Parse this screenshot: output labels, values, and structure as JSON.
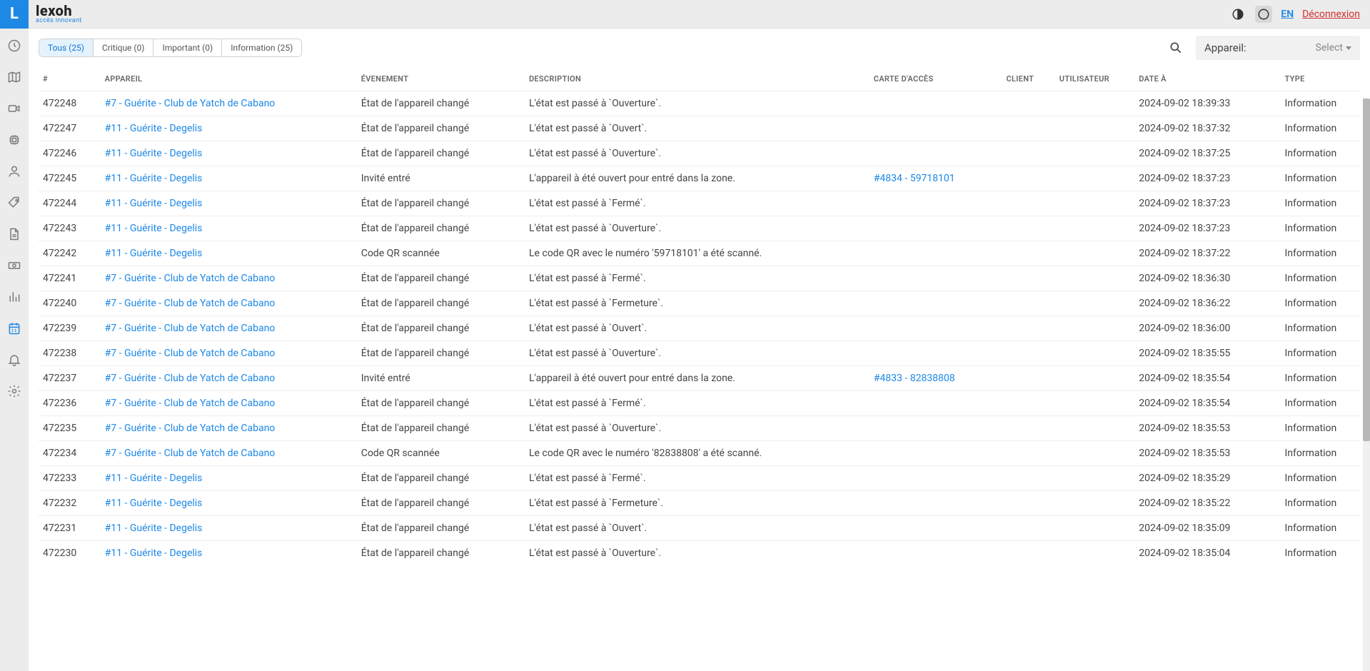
{
  "brand": {
    "name": "lexoh",
    "tagline": "accès innovant"
  },
  "topbar": {
    "lang": "EN",
    "logout": "Déconnexion"
  },
  "tabs": [
    {
      "label": "Tous (25)",
      "active": true
    },
    {
      "label": "Critique (0)",
      "active": false
    },
    {
      "label": "Important (0)",
      "active": false
    },
    {
      "label": "Information (25)",
      "active": false
    }
  ],
  "deviceFilter": {
    "label": "Appareil:",
    "select": "Select"
  },
  "columns": {
    "id": "#",
    "device": "APPAREIL",
    "event": "ÉVENEMENT",
    "description": "DESCRIPTION",
    "card": "CARTE D'ACCÈS",
    "client": "CLIENT",
    "user": "UTILISATEUR",
    "date": "DATE À",
    "type": "TYPE"
  },
  "rows": [
    {
      "id": "472248",
      "device": "#7 - Guérite - Club de Yatch de Cabano",
      "event": "État de l'appareil changé",
      "description": "L'état est passé à `Ouverture`.",
      "card": "",
      "date": "2024-09-02 18:39:33",
      "type": "Information"
    },
    {
      "id": "472247",
      "device": "#11 - Guérite - Degelis",
      "event": "État de l'appareil changé",
      "description": "L'état est passé à `Ouvert`.",
      "card": "",
      "date": "2024-09-02 18:37:32",
      "type": "Information"
    },
    {
      "id": "472246",
      "device": "#11 - Guérite - Degelis",
      "event": "État de l'appareil changé",
      "description": "L'état est passé à `Ouverture`.",
      "card": "",
      "date": "2024-09-02 18:37:25",
      "type": "Information"
    },
    {
      "id": "472245",
      "device": "#11 - Guérite - Degelis",
      "event": "Invité entré",
      "description": "L'appareil à été ouvert pour entré dans la zone.",
      "card": "#4834 - 59718101",
      "date": "2024-09-02 18:37:23",
      "type": "Information"
    },
    {
      "id": "472244",
      "device": "#11 - Guérite - Degelis",
      "event": "État de l'appareil changé",
      "description": "L'état est passé à `Fermé`.",
      "card": "",
      "date": "2024-09-02 18:37:23",
      "type": "Information"
    },
    {
      "id": "472243",
      "device": "#11 - Guérite - Degelis",
      "event": "État de l'appareil changé",
      "description": "L'état est passé à `Ouverture`.",
      "card": "",
      "date": "2024-09-02 18:37:23",
      "type": "Information"
    },
    {
      "id": "472242",
      "device": "#11 - Guérite - Degelis",
      "event": "Code QR scannée",
      "description": "Le code QR avec le numéro '59718101' a été scanné.",
      "card": "",
      "date": "2024-09-02 18:37:22",
      "type": "Information"
    },
    {
      "id": "472241",
      "device": "#7 - Guérite - Club de Yatch de Cabano",
      "event": "État de l'appareil changé",
      "description": "L'état est passé à `Fermé`.",
      "card": "",
      "date": "2024-09-02 18:36:30",
      "type": "Information"
    },
    {
      "id": "472240",
      "device": "#7 - Guérite - Club de Yatch de Cabano",
      "event": "État de l'appareil changé",
      "description": "L'état est passé à `Fermeture`.",
      "card": "",
      "date": "2024-09-02 18:36:22",
      "type": "Information"
    },
    {
      "id": "472239",
      "device": "#7 - Guérite - Club de Yatch de Cabano",
      "event": "État de l'appareil changé",
      "description": "L'état est passé à `Ouvert`.",
      "card": "",
      "date": "2024-09-02 18:36:00",
      "type": "Information"
    },
    {
      "id": "472238",
      "device": "#7 - Guérite - Club de Yatch de Cabano",
      "event": "État de l'appareil changé",
      "description": "L'état est passé à `Ouverture`.",
      "card": "",
      "date": "2024-09-02 18:35:55",
      "type": "Information"
    },
    {
      "id": "472237",
      "device": "#7 - Guérite - Club de Yatch de Cabano",
      "event": "Invité entré",
      "description": "L'appareil à été ouvert pour entré dans la zone.",
      "card": "#4833 - 82838808",
      "date": "2024-09-02 18:35:54",
      "type": "Information"
    },
    {
      "id": "472236",
      "device": "#7 - Guérite - Club de Yatch de Cabano",
      "event": "État de l'appareil changé",
      "description": "L'état est passé à `Fermé`.",
      "card": "",
      "date": "2024-09-02 18:35:54",
      "type": "Information"
    },
    {
      "id": "472235",
      "device": "#7 - Guérite - Club de Yatch de Cabano",
      "event": "État de l'appareil changé",
      "description": "L'état est passé à `Ouverture`.",
      "card": "",
      "date": "2024-09-02 18:35:53",
      "type": "Information"
    },
    {
      "id": "472234",
      "device": "#7 - Guérite - Club de Yatch de Cabano",
      "event": "Code QR scannée",
      "description": "Le code QR avec le numéro '82838808' a été scanné.",
      "card": "",
      "date": "2024-09-02 18:35:53",
      "type": "Information"
    },
    {
      "id": "472233",
      "device": "#11 - Guérite - Degelis",
      "event": "État de l'appareil changé",
      "description": "L'état est passé à `Fermé`.",
      "card": "",
      "date": "2024-09-02 18:35:29",
      "type": "Information"
    },
    {
      "id": "472232",
      "device": "#11 - Guérite - Degelis",
      "event": "État de l'appareil changé",
      "description": "L'état est passé à `Fermeture`.",
      "card": "",
      "date": "2024-09-02 18:35:22",
      "type": "Information"
    },
    {
      "id": "472231",
      "device": "#11 - Guérite - Degelis",
      "event": "État de l'appareil changé",
      "description": "L'état est passé à `Ouvert`.",
      "card": "",
      "date": "2024-09-02 18:35:09",
      "type": "Information"
    },
    {
      "id": "472230",
      "device": "#11 - Guérite - Degelis",
      "event": "État de l'appareil changé",
      "description": "L'état est passé à `Ouverture`.",
      "card": "",
      "date": "2024-09-02 18:35:04",
      "type": "Information"
    }
  ],
  "sidebarIcons": [
    "clock-icon",
    "map-icon",
    "camera-icon",
    "cpu-icon",
    "user-icon",
    "tag-icon",
    "file-icon",
    "money-icon",
    "chart-icon",
    "calendar-icon",
    "bell-icon",
    "gear-icon"
  ]
}
